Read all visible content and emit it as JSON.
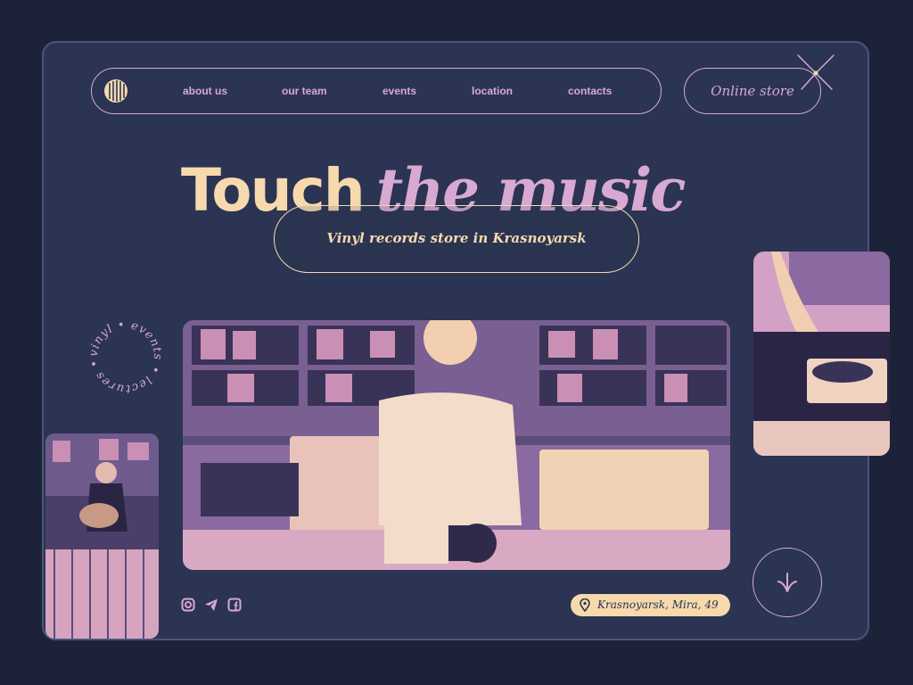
{
  "nav": {
    "links": [
      "about us",
      "our team",
      "events",
      "location",
      "contacts"
    ],
    "online_store": "Online store"
  },
  "hero": {
    "title_bold": "Touch",
    "title_italic": "the music",
    "subtitle": "Vinyl records store in Krasnoyarsk"
  },
  "circle_badge": {
    "text": "vinyl • events • lectures •"
  },
  "footer": {
    "address": "Krasnoyarsk, Mira, 49",
    "social_icons": [
      "instagram-icon",
      "telegram-icon",
      "facebook-icon"
    ]
  },
  "colors": {
    "background": "#1c2338",
    "panel": "#2b3452",
    "cream": "#f6d9ad",
    "pink": "#d8a9d2"
  }
}
